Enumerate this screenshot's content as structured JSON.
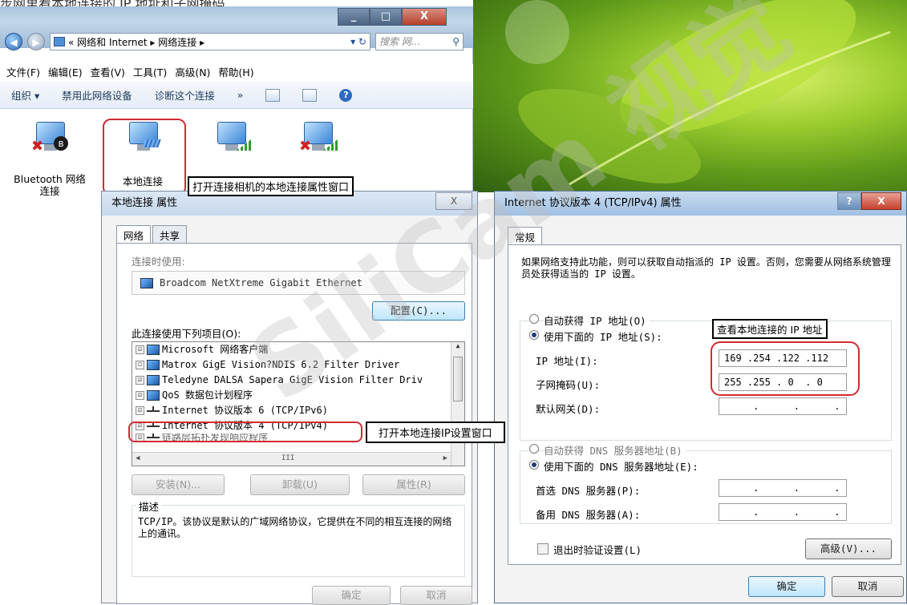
{
  "top_text": "步网里看本地连接的 IP 地址和子网掩码",
  "watermark": "SiliCam 视觉",
  "explorer": {
    "window_buttons": [
      "_",
      "□",
      "X"
    ],
    "breadcrumb": "« 网络和 Internet ▸ 网络连接 ▸",
    "search_placeholder": "搜索 网...",
    "menu": [
      "文件(F)",
      "编辑(E)",
      "查看(V)",
      "工具(T)",
      "高级(N)",
      "帮助(H)"
    ],
    "toolbar": [
      "组织 ▾",
      "禁用此网络设备",
      "诊断这个连接",
      "»"
    ],
    "connections": [
      {
        "label": "Bluetooth 网络连接"
      },
      {
        "label": "本地连接"
      },
      {
        "label": ""
      },
      {
        "label": ""
      }
    ]
  },
  "annotations": {
    "open_props": "打开连接相机的本地连接属性窗口",
    "open_ip": "打开本地连接IP设置窗口",
    "view_ip": "查看本地连接的 IP 地址"
  },
  "props_dialog": {
    "title": "本地连接 属性",
    "close_label": "X",
    "tabs": [
      "网络",
      "共享"
    ],
    "connect_using_label": "连接时使用:",
    "adapter_name": "Broadcom NetXtreme Gigabit Ethernet",
    "configure_button": "配置(C)...",
    "items_label": "此连接使用下列项目(O):",
    "items": [
      {
        "label": "Microsoft 网络客户端",
        "checked": "☑"
      },
      {
        "label": "Matrox GigE Vision?NDIS 6.2 Filter Driver",
        "checked": "☐"
      },
      {
        "label": "Teledyne DALSA Sapera GigE Vision Filter Driv",
        "checked": "☑"
      },
      {
        "label": "QoS 数据包计划程序",
        "checked": "☑"
      },
      {
        "label": "Internet 协议版本 6 (TCP/IPv6)",
        "checked": "☑"
      },
      {
        "label": "Internet 协议版本 4 (TCP/IPv4)",
        "checked": "☑"
      },
      {
        "label": "链路层拓扑发现响应程序",
        "checked": "☑"
      }
    ],
    "hscroll_label": "III",
    "install_button": "安装(N)...",
    "uninstall_button": "卸载(U)",
    "properties_button": "属性(R)",
    "description_title": "描述",
    "description_text": "TCP/IP。该协议是默认的广域网络协议，它提供在不同的相互连接的网络上的通讯。",
    "ok_button": "确定",
    "cancel_button": "取消"
  },
  "ipv4_dialog": {
    "title": "Internet 协议版本 4 (TCP/IPv4) 属性",
    "help_label": "?",
    "close_label": "X",
    "tab": "常规",
    "intro": "如果网络支持此功能，则可以获取自动指派的 IP 设置。否则，您需要从网络系统管理员处获得适当的 IP 设置。",
    "auto_ip": "自动获得 IP 地址(O)",
    "manual_ip": "使用下面的 IP 地址(S):",
    "ip_label": "IP 地址(I):",
    "ip_value": "169 .254 .122 .112",
    "mask_label": "子网掩码(U):",
    "mask_value": "255 .255 . 0  . 0",
    "gateway_label": "默认网关(D):",
    "gateway_value": "     .      .      .",
    "auto_dns": "自动获得 DNS 服务器地址(B)",
    "manual_dns": "使用下面的 DNS 服务器地址(E):",
    "dns1_label": "首选 DNS 服务器(P):",
    "dns1_value": "     .      .      .",
    "dns2_label": "备用 DNS 服务器(A):",
    "dns2_value": "     .      .      .",
    "validate_label": "退出时验证设置(L)",
    "advanced_button": "高级(V)...",
    "ok_button": "确定",
    "cancel_button": "取消"
  }
}
